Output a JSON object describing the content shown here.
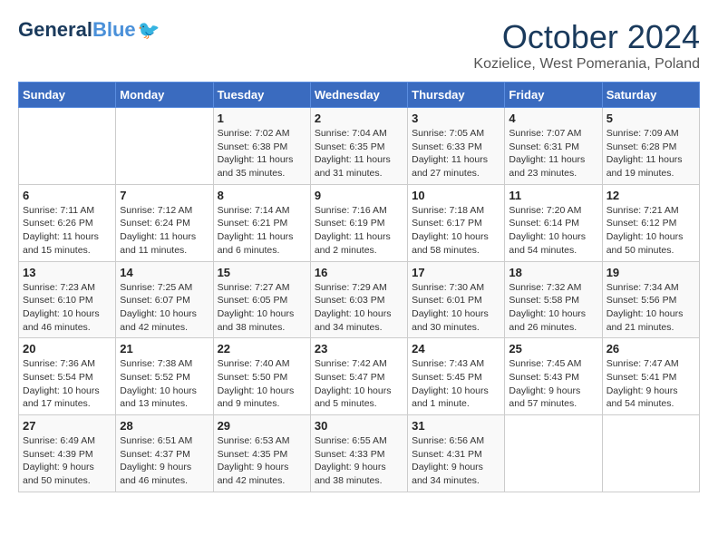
{
  "header": {
    "logo_general": "General",
    "logo_blue": "Blue",
    "month": "October 2024",
    "location": "Kozielice, West Pomerania, Poland"
  },
  "weekdays": [
    "Sunday",
    "Monday",
    "Tuesday",
    "Wednesday",
    "Thursday",
    "Friday",
    "Saturday"
  ],
  "weeks": [
    [
      {
        "day": "",
        "sunrise": "",
        "sunset": "",
        "daylight": ""
      },
      {
        "day": "",
        "sunrise": "",
        "sunset": "",
        "daylight": ""
      },
      {
        "day": "1",
        "sunrise": "Sunrise: 7:02 AM",
        "sunset": "Sunset: 6:38 PM",
        "daylight": "Daylight: 11 hours and 35 minutes."
      },
      {
        "day": "2",
        "sunrise": "Sunrise: 7:04 AM",
        "sunset": "Sunset: 6:35 PM",
        "daylight": "Daylight: 11 hours and 31 minutes."
      },
      {
        "day": "3",
        "sunrise": "Sunrise: 7:05 AM",
        "sunset": "Sunset: 6:33 PM",
        "daylight": "Daylight: 11 hours and 27 minutes."
      },
      {
        "day": "4",
        "sunrise": "Sunrise: 7:07 AM",
        "sunset": "Sunset: 6:31 PM",
        "daylight": "Daylight: 11 hours and 23 minutes."
      },
      {
        "day": "5",
        "sunrise": "Sunrise: 7:09 AM",
        "sunset": "Sunset: 6:28 PM",
        "daylight": "Daylight: 11 hours and 19 minutes."
      }
    ],
    [
      {
        "day": "6",
        "sunrise": "Sunrise: 7:11 AM",
        "sunset": "Sunset: 6:26 PM",
        "daylight": "Daylight: 11 hours and 15 minutes."
      },
      {
        "day": "7",
        "sunrise": "Sunrise: 7:12 AM",
        "sunset": "Sunset: 6:24 PM",
        "daylight": "Daylight: 11 hours and 11 minutes."
      },
      {
        "day": "8",
        "sunrise": "Sunrise: 7:14 AM",
        "sunset": "Sunset: 6:21 PM",
        "daylight": "Daylight: 11 hours and 6 minutes."
      },
      {
        "day": "9",
        "sunrise": "Sunrise: 7:16 AM",
        "sunset": "Sunset: 6:19 PM",
        "daylight": "Daylight: 11 hours and 2 minutes."
      },
      {
        "day": "10",
        "sunrise": "Sunrise: 7:18 AM",
        "sunset": "Sunset: 6:17 PM",
        "daylight": "Daylight: 10 hours and 58 minutes."
      },
      {
        "day": "11",
        "sunrise": "Sunrise: 7:20 AM",
        "sunset": "Sunset: 6:14 PM",
        "daylight": "Daylight: 10 hours and 54 minutes."
      },
      {
        "day": "12",
        "sunrise": "Sunrise: 7:21 AM",
        "sunset": "Sunset: 6:12 PM",
        "daylight": "Daylight: 10 hours and 50 minutes."
      }
    ],
    [
      {
        "day": "13",
        "sunrise": "Sunrise: 7:23 AM",
        "sunset": "Sunset: 6:10 PM",
        "daylight": "Daylight: 10 hours and 46 minutes."
      },
      {
        "day": "14",
        "sunrise": "Sunrise: 7:25 AM",
        "sunset": "Sunset: 6:07 PM",
        "daylight": "Daylight: 10 hours and 42 minutes."
      },
      {
        "day": "15",
        "sunrise": "Sunrise: 7:27 AM",
        "sunset": "Sunset: 6:05 PM",
        "daylight": "Daylight: 10 hours and 38 minutes."
      },
      {
        "day": "16",
        "sunrise": "Sunrise: 7:29 AM",
        "sunset": "Sunset: 6:03 PM",
        "daylight": "Daylight: 10 hours and 34 minutes."
      },
      {
        "day": "17",
        "sunrise": "Sunrise: 7:30 AM",
        "sunset": "Sunset: 6:01 PM",
        "daylight": "Daylight: 10 hours and 30 minutes."
      },
      {
        "day": "18",
        "sunrise": "Sunrise: 7:32 AM",
        "sunset": "Sunset: 5:58 PM",
        "daylight": "Daylight: 10 hours and 26 minutes."
      },
      {
        "day": "19",
        "sunrise": "Sunrise: 7:34 AM",
        "sunset": "Sunset: 5:56 PM",
        "daylight": "Daylight: 10 hours and 21 minutes."
      }
    ],
    [
      {
        "day": "20",
        "sunrise": "Sunrise: 7:36 AM",
        "sunset": "Sunset: 5:54 PM",
        "daylight": "Daylight: 10 hours and 17 minutes."
      },
      {
        "day": "21",
        "sunrise": "Sunrise: 7:38 AM",
        "sunset": "Sunset: 5:52 PM",
        "daylight": "Daylight: 10 hours and 13 minutes."
      },
      {
        "day": "22",
        "sunrise": "Sunrise: 7:40 AM",
        "sunset": "Sunset: 5:50 PM",
        "daylight": "Daylight: 10 hours and 9 minutes."
      },
      {
        "day": "23",
        "sunrise": "Sunrise: 7:42 AM",
        "sunset": "Sunset: 5:47 PM",
        "daylight": "Daylight: 10 hours and 5 minutes."
      },
      {
        "day": "24",
        "sunrise": "Sunrise: 7:43 AM",
        "sunset": "Sunset: 5:45 PM",
        "daylight": "Daylight: 10 hours and 1 minute."
      },
      {
        "day": "25",
        "sunrise": "Sunrise: 7:45 AM",
        "sunset": "Sunset: 5:43 PM",
        "daylight": "Daylight: 9 hours and 57 minutes."
      },
      {
        "day": "26",
        "sunrise": "Sunrise: 7:47 AM",
        "sunset": "Sunset: 5:41 PM",
        "daylight": "Daylight: 9 hours and 54 minutes."
      }
    ],
    [
      {
        "day": "27",
        "sunrise": "Sunrise: 6:49 AM",
        "sunset": "Sunset: 4:39 PM",
        "daylight": "Daylight: 9 hours and 50 minutes."
      },
      {
        "day": "28",
        "sunrise": "Sunrise: 6:51 AM",
        "sunset": "Sunset: 4:37 PM",
        "daylight": "Daylight: 9 hours and 46 minutes."
      },
      {
        "day": "29",
        "sunrise": "Sunrise: 6:53 AM",
        "sunset": "Sunset: 4:35 PM",
        "daylight": "Daylight: 9 hours and 42 minutes."
      },
      {
        "day": "30",
        "sunrise": "Sunrise: 6:55 AM",
        "sunset": "Sunset: 4:33 PM",
        "daylight": "Daylight: 9 hours and 38 minutes."
      },
      {
        "day": "31",
        "sunrise": "Sunrise: 6:56 AM",
        "sunset": "Sunset: 4:31 PM",
        "daylight": "Daylight: 9 hours and 34 minutes."
      },
      {
        "day": "",
        "sunrise": "",
        "sunset": "",
        "daylight": ""
      },
      {
        "day": "",
        "sunrise": "",
        "sunset": "",
        "daylight": ""
      }
    ]
  ]
}
